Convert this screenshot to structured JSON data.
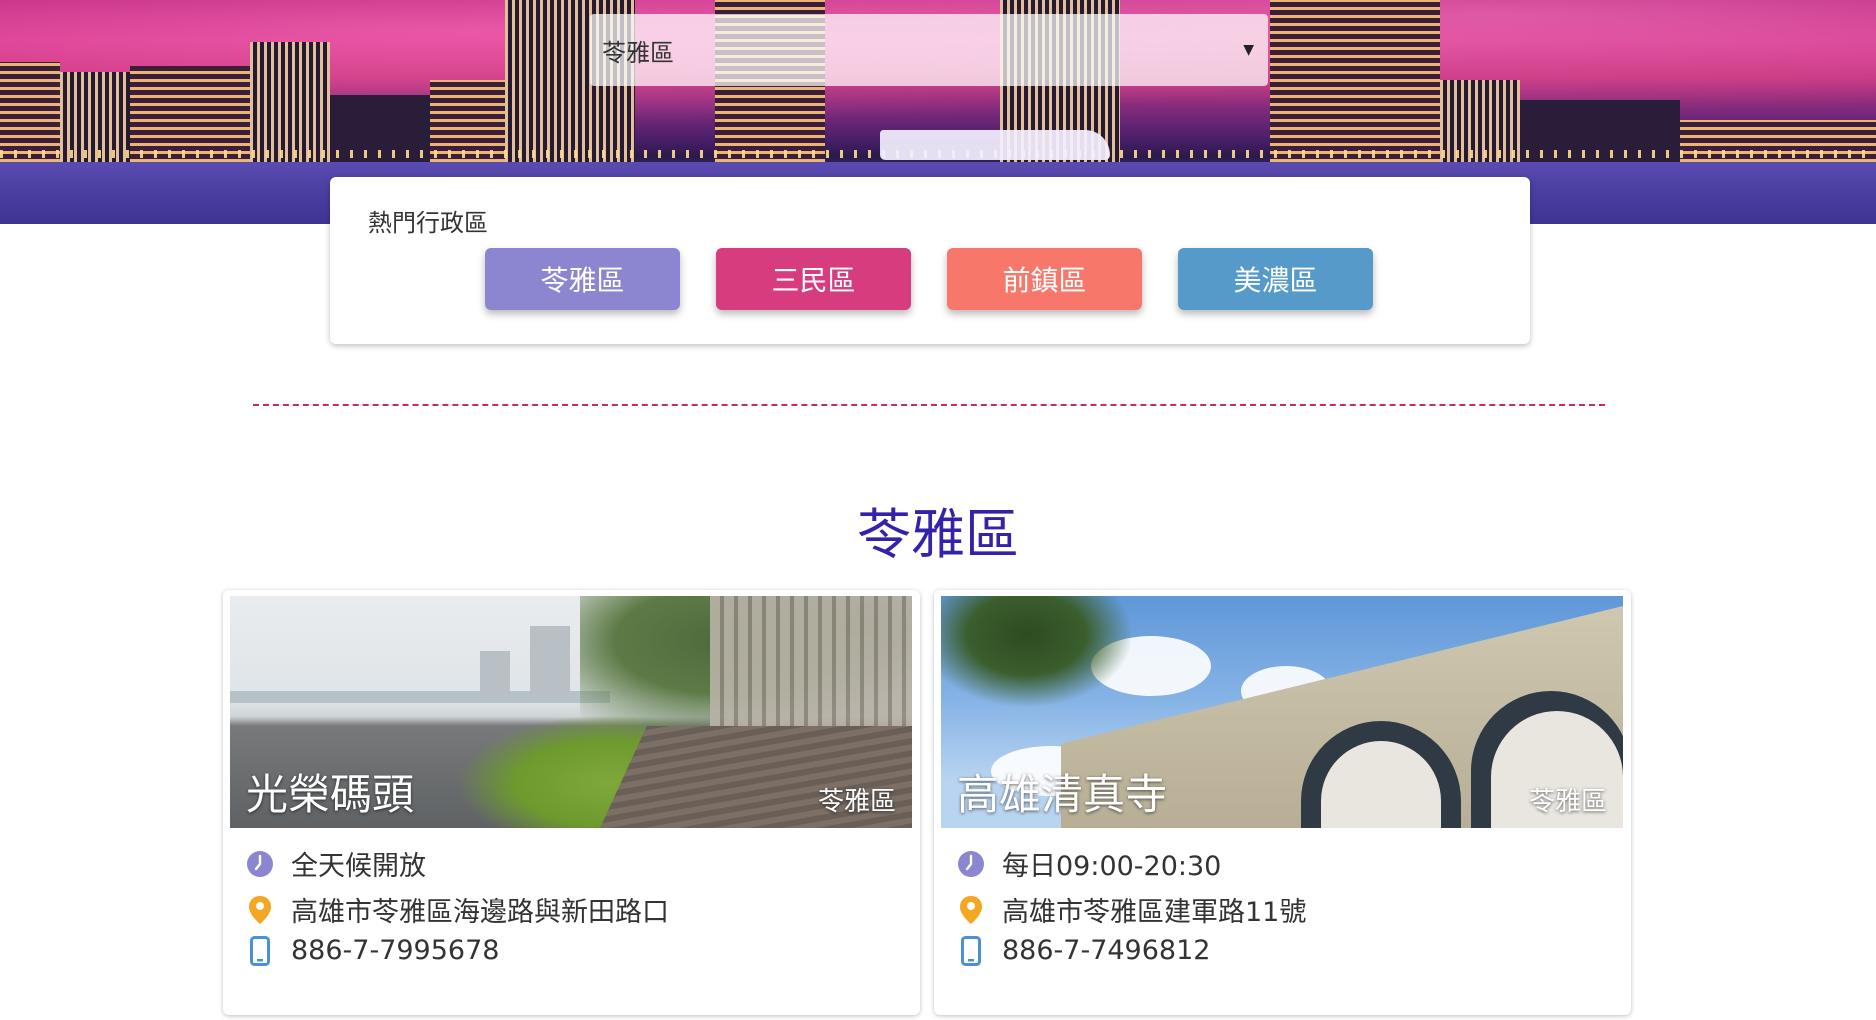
{
  "district_select": {
    "value": "苓雅區"
  },
  "popular": {
    "heading": "熱門行政區",
    "buttons": [
      {
        "label": "苓雅區",
        "color": "#8c86d0"
      },
      {
        "label": "三民區",
        "color": "#d63c7e"
      },
      {
        "label": "前鎮區",
        "color": "#f7786b"
      },
      {
        "label": "美濃區",
        "color": "#559ac8"
      }
    ]
  },
  "section_title": "苓雅區",
  "cards": [
    {
      "name": "光榮碼頭",
      "zone": "苓雅區",
      "hours": "全天候開放",
      "address": "高雄市苓雅區海邊路與新田路口",
      "phone": "886-7-7995678"
    },
    {
      "name": "高雄清真寺",
      "zone": "苓雅區",
      "hours": "每日09:00-20:30",
      "address": "高雄市苓雅區建軍路11號",
      "phone": "886-7-7496812"
    }
  ],
  "colors": {
    "title": "#3322aa",
    "divider": "#c42a6f",
    "clock_icon": "#8c86d0",
    "pin_icon": "#f5a623",
    "phone_icon": "#4a90d9"
  },
  "icons": [
    "clock-icon",
    "map-pin-icon",
    "phone-icon",
    "dropdown-caret-icon"
  ]
}
